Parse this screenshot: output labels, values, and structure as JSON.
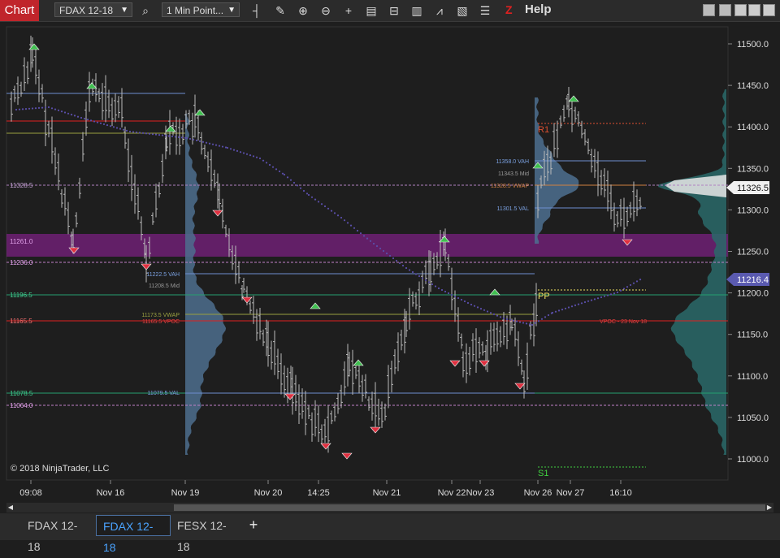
{
  "toolbar": {
    "chart_label": "Chart",
    "instrument": "FDAX 12-18",
    "interval": "1 Min Point...",
    "help_label": "Help",
    "z_label": "Z"
  },
  "price_axis": {
    "ticks": [
      "11500.0",
      "11450.0",
      "11400.0",
      "11350.0",
      "11300.0",
      "11250.0",
      "11200.0",
      "11150.0",
      "11100.0",
      "11050.0",
      "11000.0"
    ],
    "current_price": "11326.5",
    "vwap_price": "11216.4"
  },
  "time_axis": {
    "labels": [
      "09:08",
      "Nov 16",
      "Nov 19",
      "Nov 20",
      "14:25",
      "Nov 21",
      "Nov 22",
      "Nov 23",
      "Nov 26",
      "Nov 27",
      "16:10"
    ]
  },
  "levels": {
    "l11328": "11328.5",
    "l11261": "11261.0",
    "l11236": "11236.0",
    "l11196": "11196.5",
    "l11165": "11165.5",
    "l11078": "11078.5",
    "l11064": "11064.0"
  },
  "profile_labels": {
    "vah1": "11222.5 VAH",
    "mid1": "11208.5 Mid",
    "vwap1": "11173.5 VWAP",
    "vpoc1": "11165.5 VPOC",
    "val1": "11079.5 VAL",
    "vah2": "11358.0 VAH",
    "mid2": "11343.5 Mid",
    "vwap2": "11328.5 VWAP",
    "val2": "11301.5 VAL",
    "vpoc_note": "VPOC - 23 Nov 18"
  },
  "pivots": {
    "r1": "R1",
    "pp": "PP",
    "s1": "S1"
  },
  "copyright": "© 2018 NinjaTrader, LLC",
  "tabs": [
    {
      "label": "FDAX 12-18"
    },
    {
      "label": "FDAX 12-18"
    },
    {
      "label": "FESX 12-18"
    }
  ],
  "tab_add": "+",
  "colors": {
    "chart_tab": "#c0252b",
    "vah_line": "#6f8fd0",
    "vpoc_line": "#e02020",
    "band": "#7a2080",
    "green_line": "#25a070",
    "vwap_dots": "#5a4ea8",
    "profile_fill": "#4a6a8a",
    "price_marker": "#ffffff",
    "vwap_marker": "#5a5ab0"
  }
}
